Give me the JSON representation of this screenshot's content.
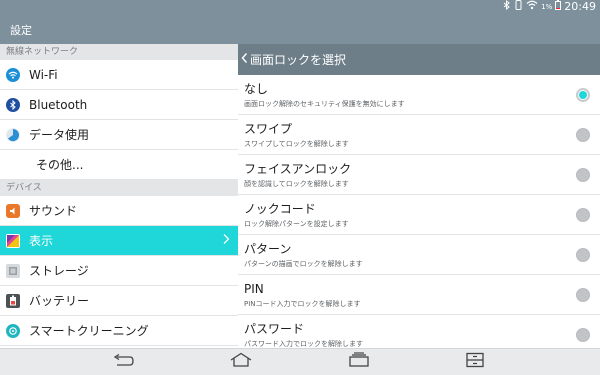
{
  "status": {
    "battery_percent": "1%",
    "time": "20:49"
  },
  "app": {
    "title": "設定"
  },
  "sidebar": {
    "sections": [
      {
        "header": "無線ネットワーク",
        "items": [
          {
            "label": "Wi-Fi",
            "icon": "wifi-icon",
            "icon_color": "#1a8fd8"
          },
          {
            "label": "Bluetooth",
            "icon": "bluetooth-icon",
            "icon_color": "#1f4fa0"
          },
          {
            "label": "データ使用",
            "icon": "data-usage-icon",
            "icon_color": "#2a8fd3"
          },
          {
            "label": "その他...",
            "icon": ""
          }
        ]
      },
      {
        "header": "デバイス",
        "items": [
          {
            "label": "サウンド",
            "icon": "sound-icon",
            "icon_color": "#e8782a"
          },
          {
            "label": "表示",
            "icon": "display-icon",
            "icon_color": "#7a3aa8",
            "selected": true
          },
          {
            "label": "ストレージ",
            "icon": "storage-icon",
            "icon_color": "#8d9296"
          },
          {
            "label": "バッテリー",
            "icon": "battery-icon",
            "icon_color": "#4d5257"
          },
          {
            "label": "スマートクリーニング",
            "icon": "smart-cleaning-icon",
            "icon_color": "#1fb6c0"
          }
        ]
      }
    ]
  },
  "panel": {
    "title": "画面ロックを選択",
    "options": [
      {
        "title": "なし",
        "subtitle": "画面ロック解除のセキュリティ保護を無効にします",
        "selected": true
      },
      {
        "title": "スワイプ",
        "subtitle": "スワイプしてロックを解除します",
        "selected": false
      },
      {
        "title": "フェイスアンロック",
        "subtitle": "顔を認識してロックを解除します",
        "selected": false
      },
      {
        "title": "ノックコード",
        "subtitle": "ロック解除パターンを設定します",
        "selected": false
      },
      {
        "title": "パターン",
        "subtitle": "パターンの描画でロックを解除します",
        "selected": false
      },
      {
        "title": "PIN",
        "subtitle": "PINコード入力でロックを解除します",
        "selected": false
      },
      {
        "title": "パスワード",
        "subtitle": "パスワード入力でロックを解除します",
        "selected": false
      }
    ]
  },
  "colors": {
    "accent": "#1fd6d8",
    "appbar": "#7d909c",
    "panel_header": "#6d7e88"
  }
}
